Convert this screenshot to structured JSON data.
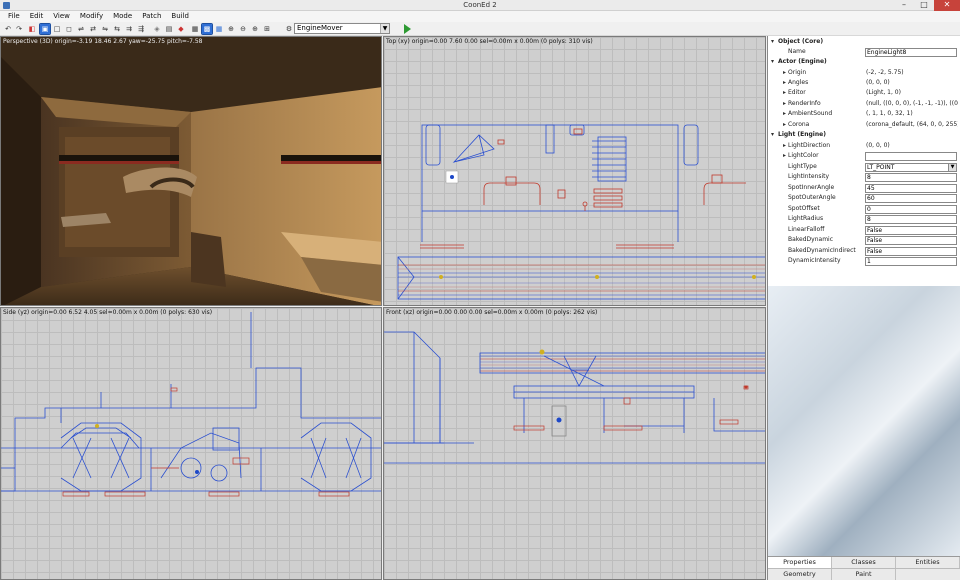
{
  "window": {
    "title": "CoonEd 2"
  },
  "menu": [
    "File",
    "Edit",
    "View",
    "Modify",
    "Mode",
    "Patch",
    "Build"
  ],
  "toolbar": {
    "class_combo": "EngineMover"
  },
  "viewports": {
    "perspective": "Perspective (3D) origin=-3.19 18.46 2.67 yaw=-25.75 pitch=-7.58",
    "top": "Top (xy) origin=0.00 7.60 0.00 sel=0.00m x 0.00m (0 polys: 310 vis)",
    "side": "Side (yz) origin=0.00 6.52 4.05 sel=0.00m x 0.00m (0 polys: 630 vis)",
    "front": "Front (xz) origin=0.00 0.00 0.00 sel=0.00m x 0.00m (0 polys: 262 vis)"
  },
  "properties": {
    "object_section": "Object (Core)",
    "name_label": "Name",
    "name_value": "EngineLight8",
    "actor_section": "Actor (Engine)",
    "actor_rows": [
      {
        "key": "Origin",
        "value": "(-2, -2, 5.75)"
      },
      {
        "key": "Angles",
        "value": "(0, 0, 0)"
      },
      {
        "key": "Editor",
        "value": "(Light, 1, 0)"
      },
      {
        "key": "RenderInfo",
        "value": "(null, ((0, 0, 0), (-1, -1, -1)), ((0,"
      },
      {
        "key": "AmbientSound",
        "value": "(, 1, 1, 0, 32, 1)"
      },
      {
        "key": "Corona",
        "value": "(corona_default, (64, 0, 0, 255)"
      }
    ],
    "light_section": "Light (Engine)",
    "light_direction_key": "LightDirection",
    "light_direction_value": "(0, 0, 0)",
    "light_color_key": "LightColor",
    "light_color_value": "",
    "light_type_key": "LightType",
    "light_type_value": "LT_POINT",
    "light_rows": [
      {
        "key": "LightIntensity",
        "value": "8"
      },
      {
        "key": "SpotInnerAngle",
        "value": "45"
      },
      {
        "key": "SpotOuterAngle",
        "value": "60"
      },
      {
        "key": "SpotOffset",
        "value": "0"
      },
      {
        "key": "LightRadius",
        "value": "8"
      },
      {
        "key": "LinearFalloff",
        "value": "False"
      },
      {
        "key": "BakedDynamic",
        "value": "False"
      },
      {
        "key": "BakedDynamicIndirect",
        "value": "False"
      },
      {
        "key": "DynamicIntensity",
        "value": "1"
      }
    ]
  },
  "tabs_row1": [
    "Properties",
    "Classes",
    "Entities"
  ],
  "tabs_row2": [
    "Geometry",
    "Paint"
  ],
  "colors": {
    "accent": "#2f6fd6",
    "brush_blue": "#2a4fd0",
    "brush_red": "#c0392b",
    "close": "#c7433b"
  }
}
